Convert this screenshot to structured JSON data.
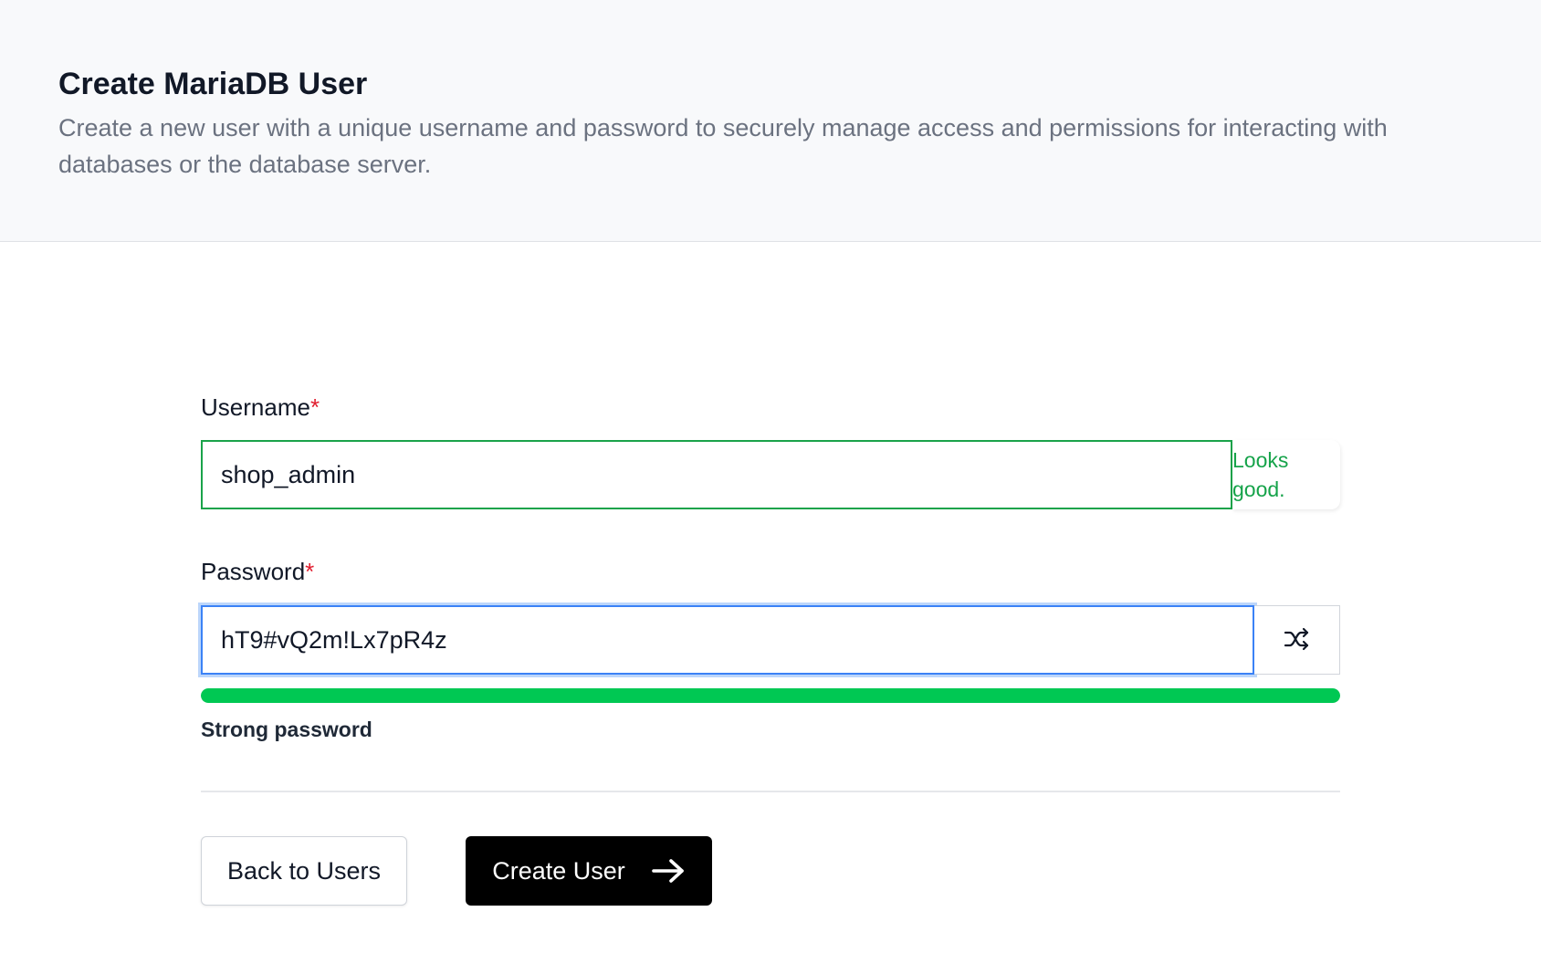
{
  "header": {
    "title": "Create MariaDB User",
    "description": "Create a new user with a unique username and password to securely manage access and permissions for interacting with databases or the database server."
  },
  "form": {
    "username": {
      "label": "Username",
      "required_mark": "*",
      "value": "shop_admin",
      "feedback": "Looks good."
    },
    "password": {
      "label": "Password",
      "required_mark": "*",
      "value": "hT9#vQ2m!Lx7pR4z",
      "generate_icon": "shuffle-icon"
    },
    "strength": {
      "label": "Strong password",
      "level_percent": 100,
      "color": "#00c853"
    }
  },
  "actions": {
    "back_label": "Back to Users",
    "create_label": "Create User",
    "create_icon": "arrow-right-icon"
  },
  "colors": {
    "valid": "#16a34a",
    "focus": "#3b82f6",
    "required": "#e11d2e",
    "primary_button": "#000000"
  }
}
